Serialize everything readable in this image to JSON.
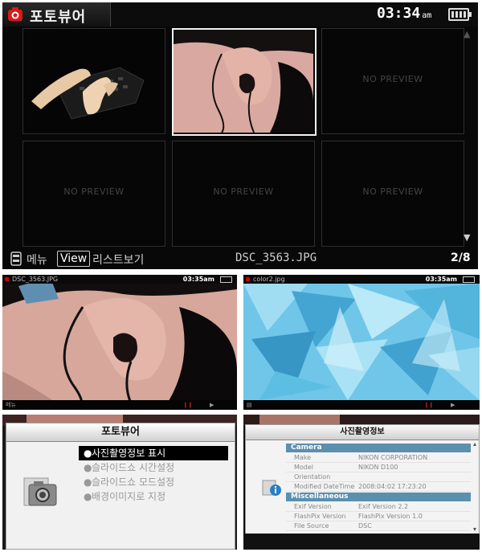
{
  "main": {
    "title": "포토뷰어",
    "clock": "03:34",
    "clock_suffix": "am",
    "no_preview": "NO PREVIEW",
    "thumbnails": [
      {
        "kind": "photo",
        "subject": "keyboard-hands"
      },
      {
        "kind": "photo",
        "subject": "ear-closeup",
        "selected": true
      },
      {
        "kind": "placeholder"
      },
      {
        "kind": "placeholder"
      },
      {
        "kind": "placeholder"
      },
      {
        "kind": "placeholder"
      }
    ],
    "bottom": {
      "menu_label": "메뉴",
      "view_key": "View",
      "list_label": "리스트보기",
      "filename": "DSC_3563.JPG",
      "page": "2/8"
    }
  },
  "photo_viewer_1": {
    "filename": "DSC_3563.JPG",
    "clock": "03:35",
    "clock_suffix": "am",
    "bottom_left": "메뉴"
  },
  "photo_viewer_2": {
    "filename": "color2.jpg",
    "clock": "03:35",
    "clock_suffix": "am"
  },
  "popup_menu": {
    "title": "포토뷰어",
    "items": [
      {
        "label": "사진촬영정보 표시",
        "selected": true
      },
      {
        "label": "슬라이드쇼 시간설정",
        "selected": false
      },
      {
        "label": "슬라이드쇼 모드설정",
        "selected": false
      },
      {
        "label": "배경이미지로 지정",
        "selected": false
      }
    ]
  },
  "photo_info": {
    "title": "사진촬영정보",
    "sections": [
      {
        "name": "Camera",
        "rows": [
          {
            "k": "Make",
            "v": "NIKON CORPORATION"
          },
          {
            "k": "Model",
            "v": "NIKON D100"
          },
          {
            "k": "Orientation",
            "v": ""
          },
          {
            "k": "Modified DateTime",
            "v": "2008:04:02 17:23:20"
          }
        ]
      },
      {
        "name": "Miscellaneous",
        "rows": [
          {
            "k": "Exif Version",
            "v": "Exif Version 2.2"
          },
          {
            "k": "FlashPix Version",
            "v": "FlashPix Version 1.0"
          },
          {
            "k": "File Source",
            "v": "DSC"
          }
        ]
      }
    ]
  },
  "colors": {
    "accent_red": "#d81a1a",
    "info_section": "#5b8fae",
    "frame_bg": "#000000"
  }
}
